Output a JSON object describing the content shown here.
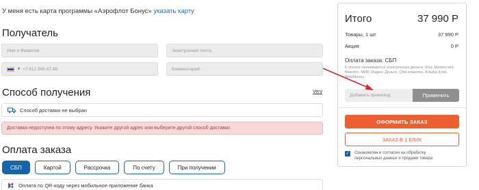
{
  "loyalty": {
    "text": "У меня есть карта программы «Аэрофлот Бонус»",
    "link": "указать карту"
  },
  "recipient": {
    "heading": "Получатель",
    "name_placeholder": "Имя и Фамилия",
    "email_placeholder": "Электронная почта",
    "phone_placeholder": "+7 912 345-67-89",
    "comment_placeholder": "Комментарий"
  },
  "delivery": {
    "heading": "Способ получения",
    "link": "Very",
    "method": "Способ доставки не выбран",
    "warning": "Доставка недоступна по этому адресу. Укажите другой адрес или выберите другой способ доставки."
  },
  "payment": {
    "heading": "Оплата заказа",
    "tabs": [
      "СБП",
      "Картой",
      "Рассрочка",
      "По счету",
      "При получении"
    ],
    "active_tab": "СБП",
    "qr_option": "Оплата по QR-коду через мобильное приложение банка"
  },
  "summary": {
    "title": "Итого",
    "total": "37 990 Р",
    "items_label": "Товары, 1 шт",
    "items_value": "37 990 Р",
    "promo_label": "Акция",
    "promo_value": "0 Р",
    "pay_method": "Оплата заказа: СБП",
    "note": "К оплате принимаются электронные деньги: Visa, Mastercard, Maestro, МИР, Яндекс.Деньги, Qiwi-кошелек, Альфа-Клик, WebMoney.",
    "promo_placeholder": "Добавить промокод",
    "apply_label": "Применить",
    "order_label": "ОФОРМИТЬ ЗАКАЗ",
    "oneclick_label": "ЗАКАЗ В 1 КЛИК",
    "agree_text": "Ознакомлен и согласен на обработку персональных данных и продажи товара"
  },
  "colors": {
    "accent_blue": "#1565a8",
    "order_orange": "#ee5f2f",
    "annotation_red": "#e0242b",
    "warning_bg": "#f6dada"
  },
  "icons": [
    "russia-flag-icon",
    "truck-icon",
    "sbp-logo-icon",
    "checkbox-checked-icon",
    "annotation-arrow"
  ]
}
